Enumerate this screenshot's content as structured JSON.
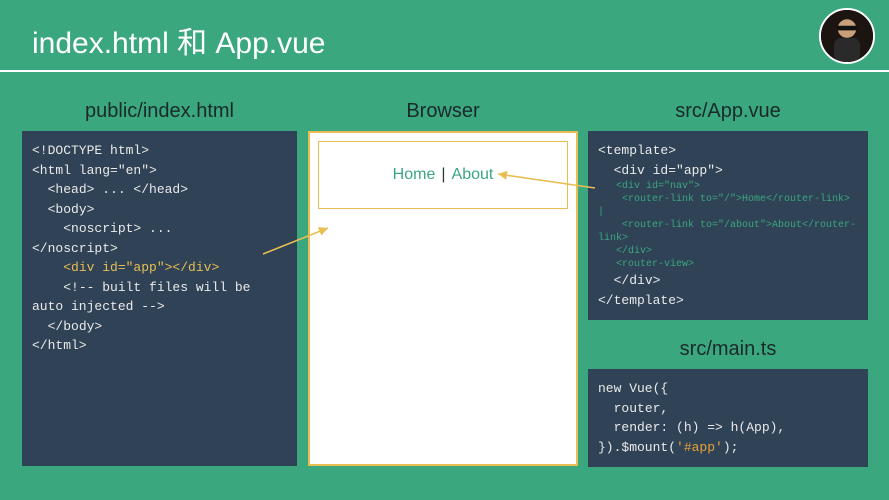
{
  "title": "index.html 和 App.vue",
  "left": {
    "label": "public/index.html",
    "code_l1": "<!DOCTYPE html>",
    "code_l2": "<html lang=\"en\">",
    "code_l3": "  <head> ... </head>",
    "code_l4": "  <body>",
    "code_l5": "    <noscript> ...",
    "code_l6": "</noscript>",
    "code_l7": "    <div id=\"app\"></div>",
    "code_l8": "    <!-- built files will be auto injected -->",
    "code_l9": "  </body>",
    "code_l10": "</html>"
  },
  "mid": {
    "label": "Browser",
    "nav_home": "Home",
    "nav_sep": "|",
    "nav_about": "About"
  },
  "right_app": {
    "label": "src/App.vue",
    "l1": "<template>",
    "l2": "  <div id=\"app\">",
    "s1": "   <div id=\"nav\">",
    "s2": "    <router-link to=\"/\">Home</router-link> |",
    "s3": "    <router-link to=\"/about\">About</router-link>",
    "s4": "   </div>",
    "s5": "   <router-view>",
    "l3": "  </div>",
    "l4": "</template>"
  },
  "right_main": {
    "label": "src/main.ts",
    "l1": "new Vue({",
    "l2": "  router,",
    "l3": "  render: (h) => h(App),",
    "l4a": "}).$mount(",
    "l4b": "'#app'",
    "l4c": ");"
  }
}
